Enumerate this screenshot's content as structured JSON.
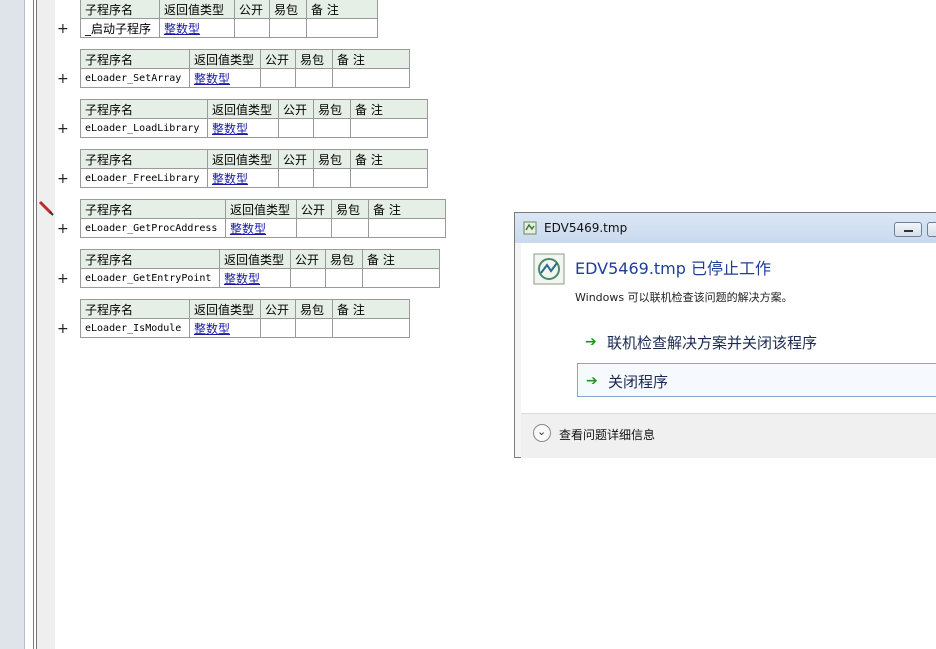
{
  "header_labels": [
    "子程序名",
    "返回值类型",
    "公开",
    "易包",
    "备 注"
  ],
  "tables": [
    {
      "name": "_启动子程序",
      "type": "整数型"
    },
    {
      "name": "eLoader_SetArray",
      "type": "整数型"
    },
    {
      "name": "eLoader_LoadLibrary",
      "type": "整数型"
    },
    {
      "name": "eLoader_FreeLibrary",
      "type": "整数型"
    },
    {
      "name": "eLoader_GetProcAddress",
      "type": "整数型"
    },
    {
      "name": "eLoader_GetEntryPoint",
      "type": "整数型"
    },
    {
      "name": "eLoader_IsModule",
      "type": "整数型"
    }
  ],
  "expand_symbol": "+",
  "dialog": {
    "title": "EDV5469.tmp",
    "heading": "EDV5469.tmp 已停止工作",
    "message": "Windows 可以联机检查该问题的解决方案。",
    "option1": "联机检查解决方案并关闭该程序",
    "option2": "关闭程序",
    "details": "查看问题详细信息",
    "arrow_symbol": "➔",
    "chevron_symbol": "⌄"
  }
}
